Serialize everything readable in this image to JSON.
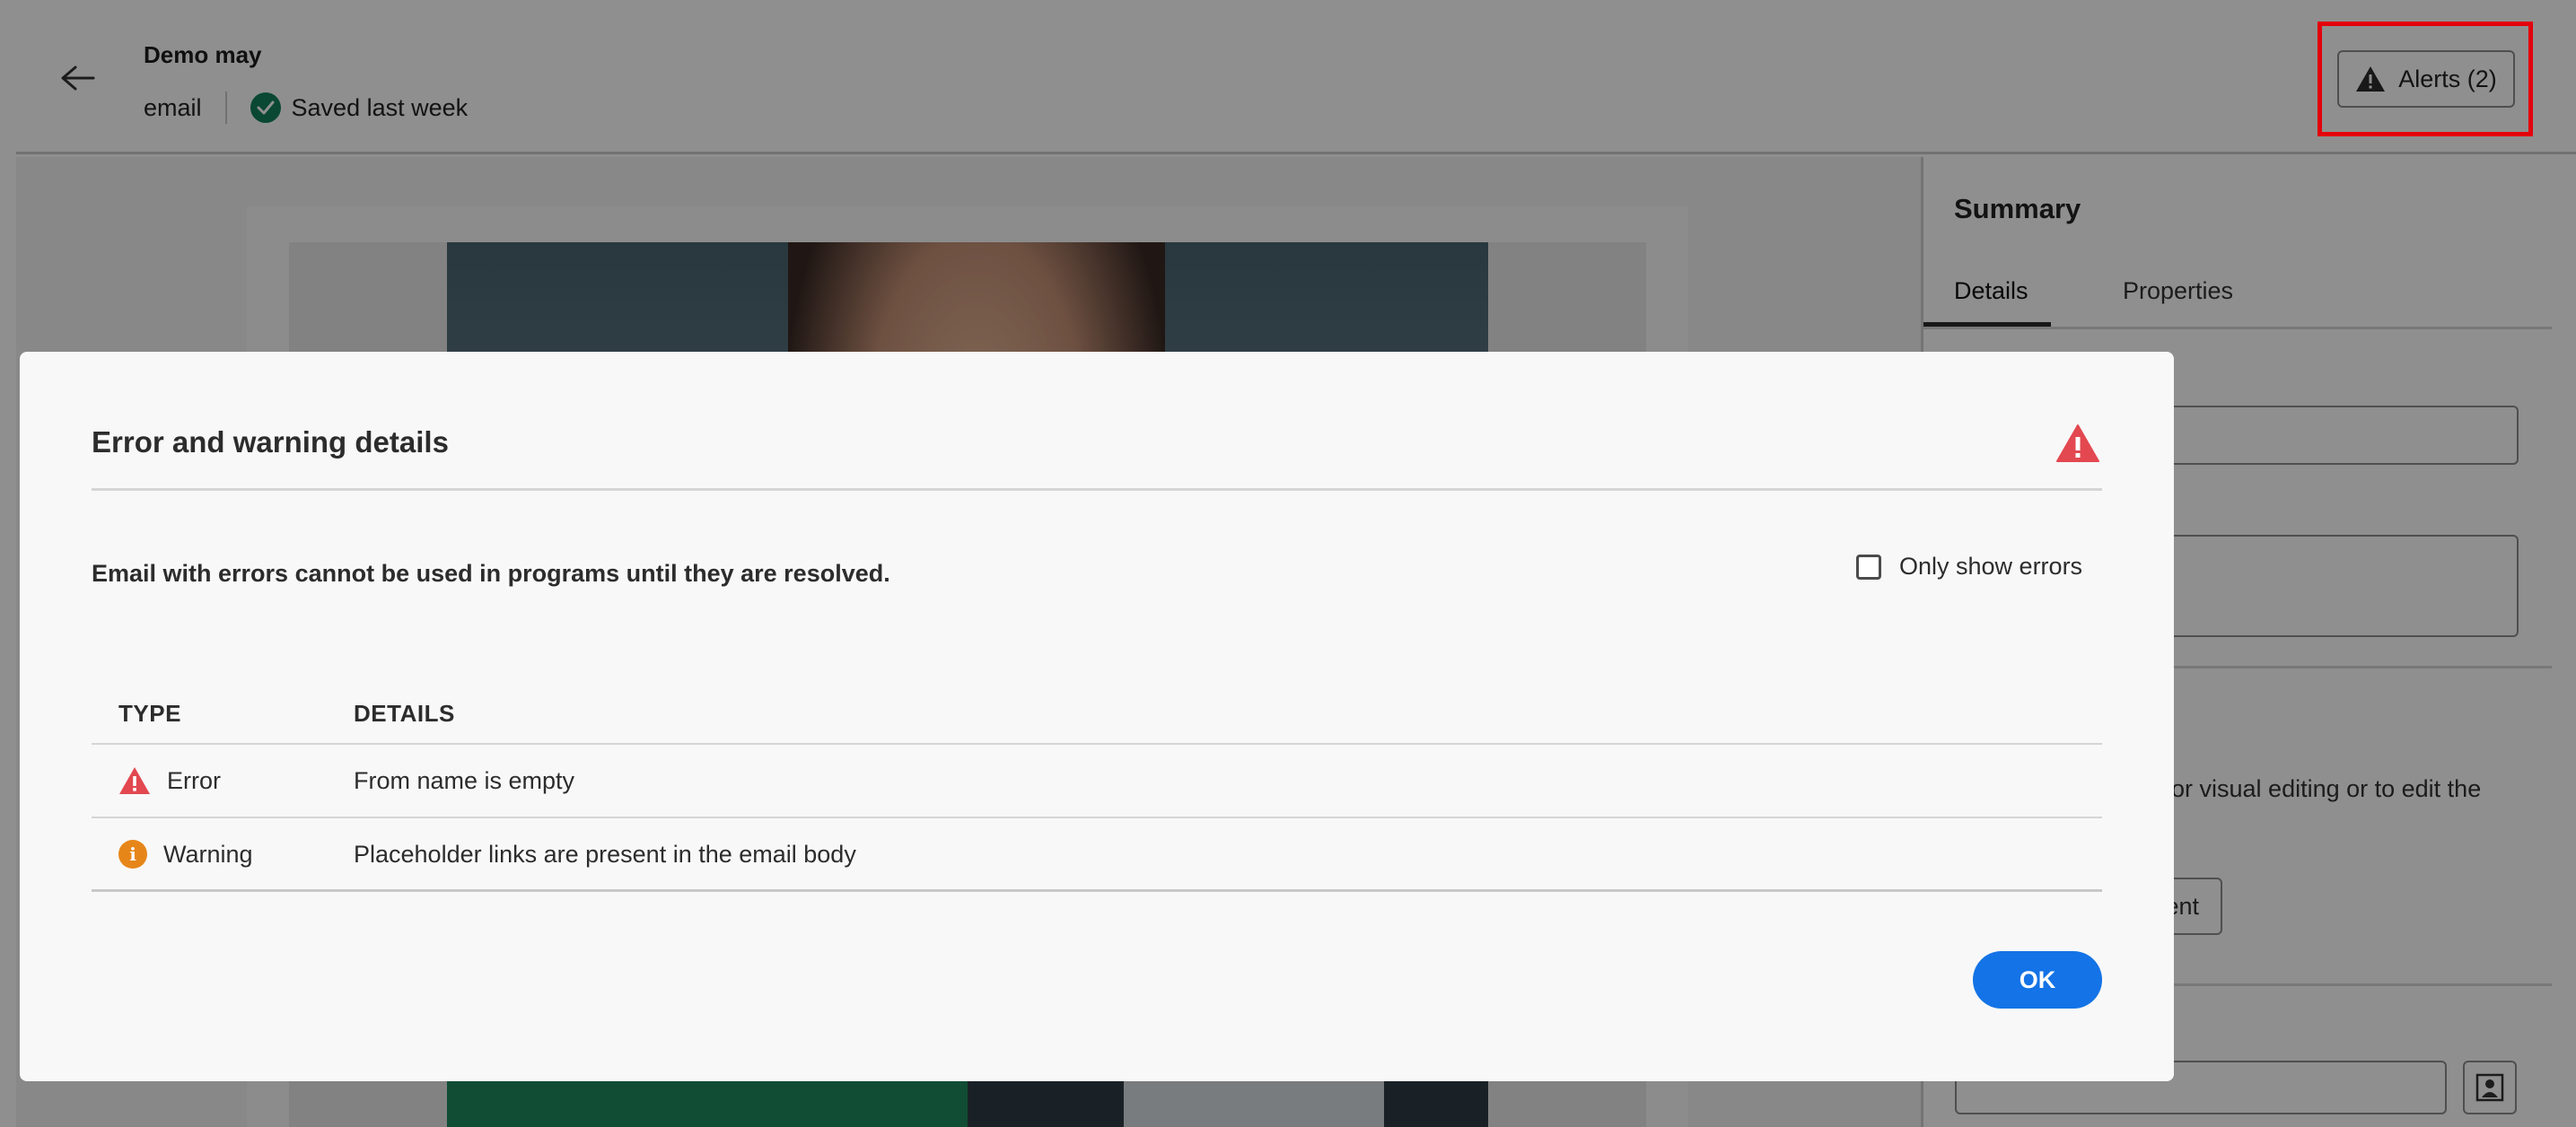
{
  "header": {
    "title": "Demo may",
    "channel": "email",
    "saved_status": "Saved last week",
    "alerts_label": "Alerts (2)"
  },
  "right_panel": {
    "title": "Summary",
    "tabs": [
      {
        "label": "Details",
        "active": true
      },
      {
        "label": "Properties",
        "active": false
      }
    ],
    "partial_text": "er for visual editing or to edit the",
    "partial_button": "ent"
  },
  "dialog": {
    "title": "Error and warning details",
    "message": "Email with errors cannot be used in programs until they are resolved.",
    "only_show_errors_label": "Only show errors",
    "only_show_errors_checked": false,
    "columns": [
      "TYPE",
      "DETAILS"
    ],
    "rows": [
      {
        "type": "Error",
        "icon": "error-triangle-icon",
        "details": "From name is empty"
      },
      {
        "type": "Warning",
        "icon": "info-circle-icon",
        "details": "Placeholder links are present in the email body"
      }
    ],
    "ok_label": "OK"
  },
  "colors": {
    "accent": "#1473e6",
    "error": "#e34850",
    "warning": "#e68619",
    "success": "#12805c",
    "highlight": "#e3000b"
  }
}
